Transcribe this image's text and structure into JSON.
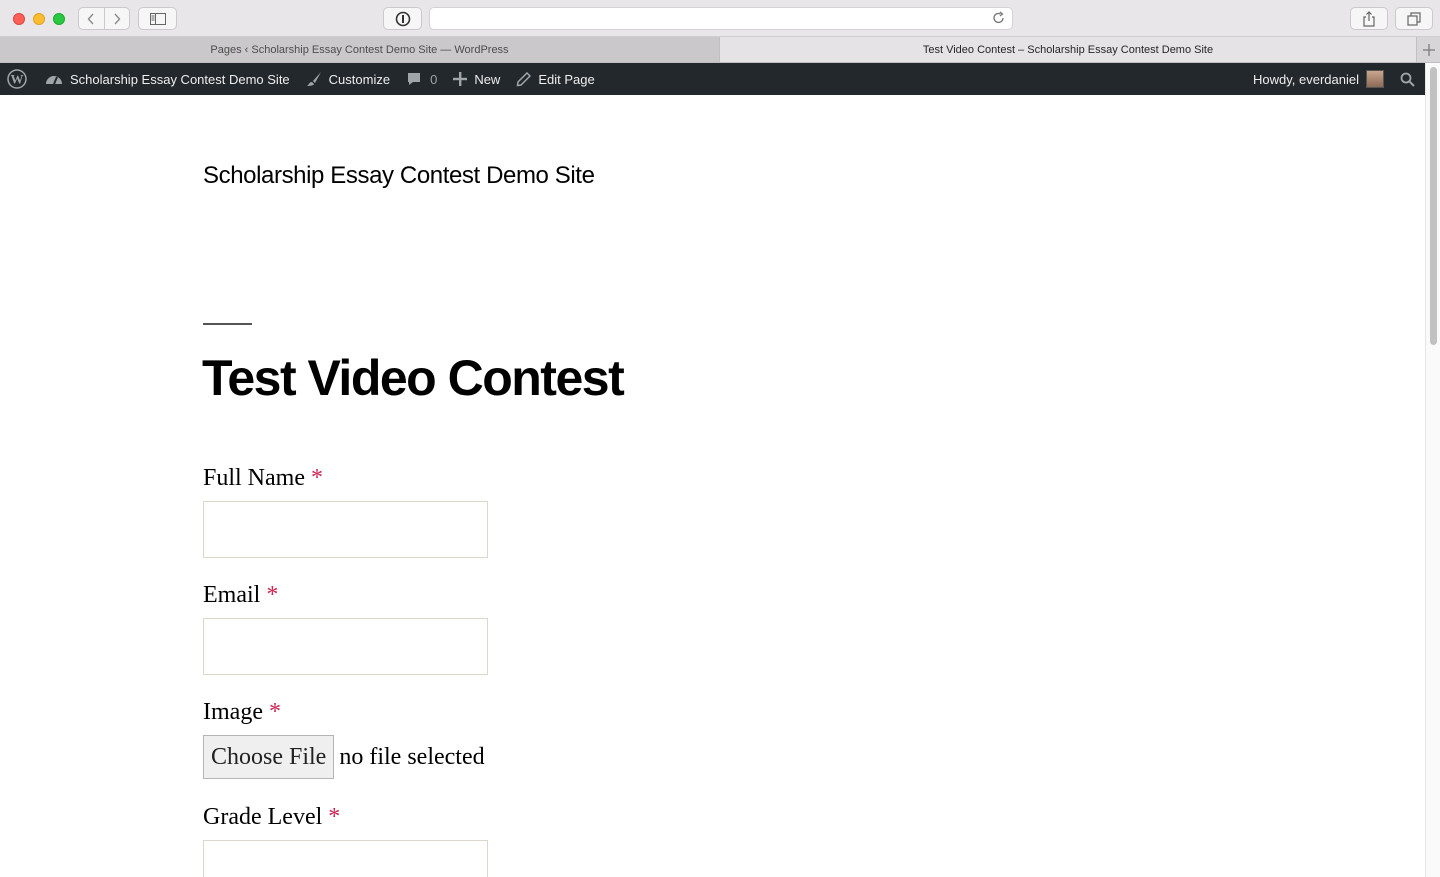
{
  "browser": {
    "url": "",
    "tabs": [
      {
        "label": "Pages ‹ Scholarship Essay Contest Demo Site — WordPress",
        "active": false
      },
      {
        "label": "Test Video Contest – Scholarship Essay Contest Demo Site",
        "active": true
      }
    ]
  },
  "adminbar": {
    "site_name": "Scholarship Essay Contest Demo Site",
    "customize": "Customize",
    "comment_count": "0",
    "new": "New",
    "edit_page": "Edit Page",
    "greeting": "Howdy, everdaniel"
  },
  "page": {
    "site_title": "Scholarship Essay Contest Demo Site",
    "title": "Test Video Contest",
    "form": {
      "full_name_label": "Full Name",
      "email_label": "Email",
      "image_label": "Image",
      "grade_level_label": "Grade Level",
      "required_marker": "*",
      "choose_file_label": "Choose File",
      "file_status": "no file selected"
    }
  },
  "colors": {
    "adminbar_bg": "#23282d",
    "required": "#cd2653",
    "input_border": "#dcd7ca"
  }
}
